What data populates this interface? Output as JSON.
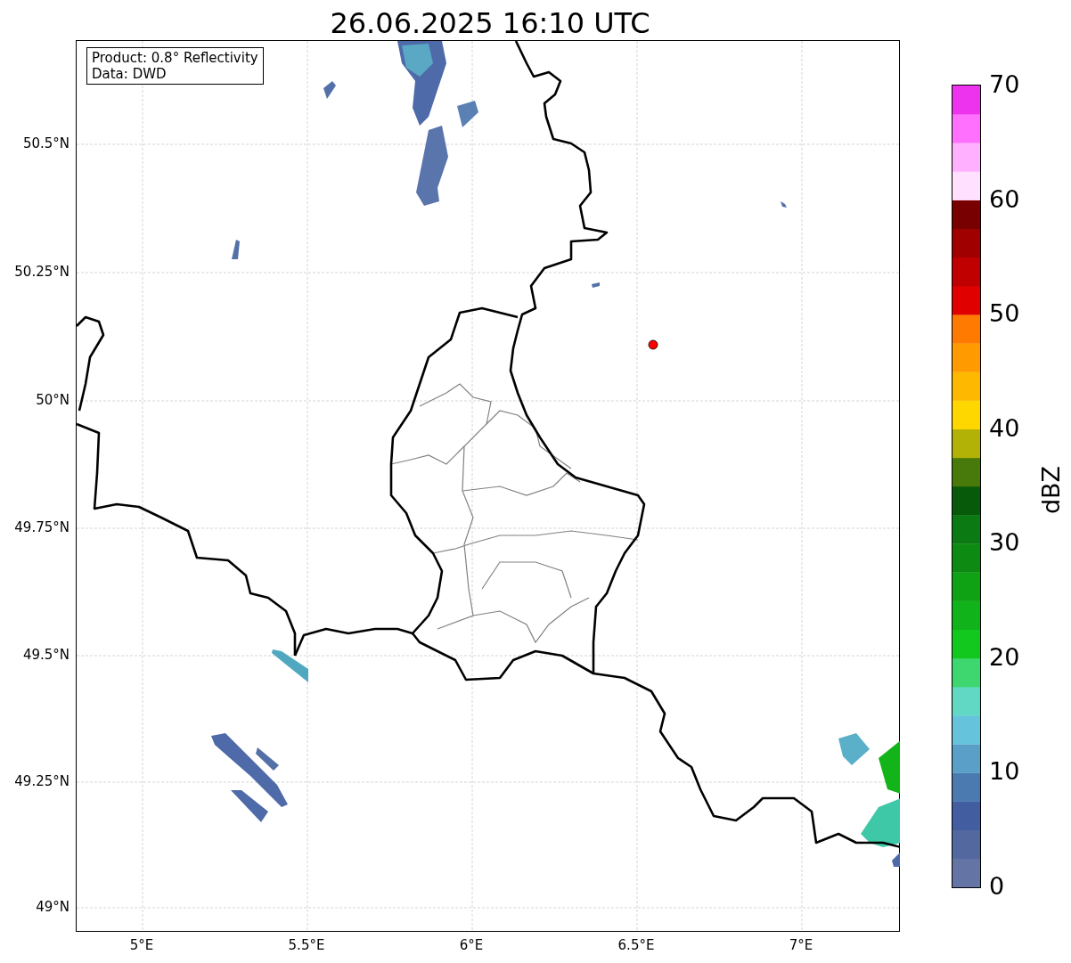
{
  "title": "26.06.2025 16:10 UTC",
  "info_box": {
    "lines": [
      "Product: 0.8° Reflectivity",
      "Data: DWD"
    ]
  },
  "map": {
    "xticks": [
      "5°E",
      "5.5°E",
      "6°E",
      "6.5°E",
      "7°E"
    ],
    "yticks": [
      "50.5°N",
      "50.25°N",
      "50°N",
      "49.75°N",
      "49.5°N",
      "49.25°N",
      "49°N"
    ]
  },
  "colorbar": {
    "label": "dBZ",
    "ticks": [
      "70",
      "60",
      "50",
      "40",
      "30",
      "20",
      "10",
      "0"
    ],
    "bands": [
      {
        "color": "#6475a5"
      },
      {
        "color": "#5468a0"
      },
      {
        "color": "#435ea0"
      },
      {
        "color": "#4a7ab0"
      },
      {
        "color": "#5a9fc8"
      },
      {
        "color": "#66c3dc"
      },
      {
        "color": "#60d8c4"
      },
      {
        "color": "#3ed66e"
      },
      {
        "color": "#12c81e"
      },
      {
        "color": "#10b41a"
      },
      {
        "color": "#0fa214"
      },
      {
        "color": "#0d8a12"
      },
      {
        "color": "#0c7a12"
      },
      {
        "color": "#065a0a"
      },
      {
        "color": "#477a0a"
      },
      {
        "color": "#b1b106"
      },
      {
        "color": "#ffd700"
      },
      {
        "color": "#ffb800"
      },
      {
        "color": "#ff9a00"
      },
      {
        "color": "#ff7a00"
      },
      {
        "color": "#e00000"
      },
      {
        "color": "#c00000"
      },
      {
        "color": "#a00000"
      },
      {
        "color": "#780000"
      },
      {
        "color": "#ffe0ff"
      },
      {
        "color": "#ffb0ff"
      },
      {
        "color": "#ff70ff"
      },
      {
        "color": "#ee33ee"
      }
    ]
  }
}
